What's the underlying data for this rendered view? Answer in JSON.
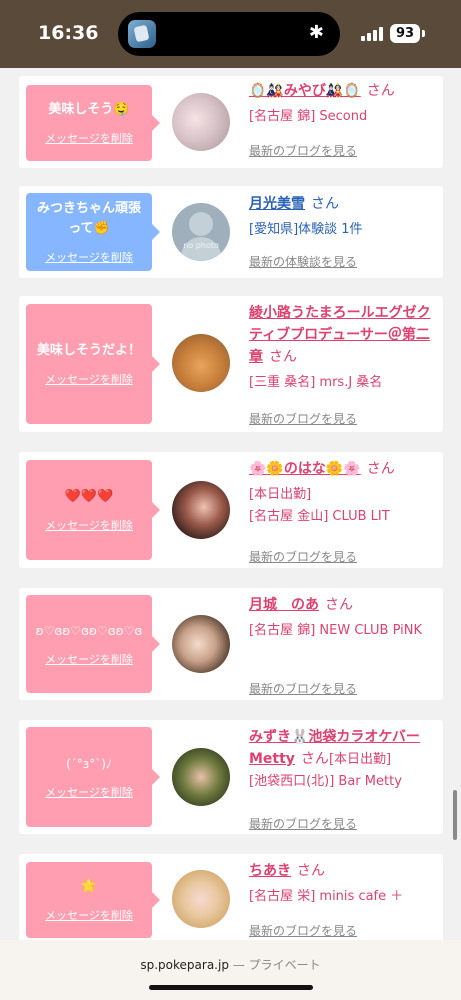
{
  "status": {
    "time": "16:36",
    "battery": "93"
  },
  "footer": {
    "domain": "sp.pokepara.jp",
    "mode": "— プライベート"
  },
  "cards": [
    {
      "message": "美味しそう🤤",
      "delete": "メッセージを削除",
      "name": "🪞🎎みやび🎎🪞",
      "san": "さん",
      "shop": "[名古屋 錦] Second",
      "blog": "最新のブログを見る"
    },
    {
      "message": "みつきちゃん頑張って✊",
      "delete": "メッセージを削除",
      "name": "月光美雪",
      "san": "さん",
      "shop": "[愛知県]体験談 1件",
      "blog": "最新の体験談を見る",
      "avatar_text": "no photo"
    },
    {
      "message": "美味しそうだよ！",
      "delete": "メッセージを削除",
      "name": "綾小路うたまろールエグゼクティブプロデューサー＠第二章",
      "san": "さん",
      "shop": "[三重 桑名] mrs.J 桑名",
      "blog": "最新のブログを見る"
    },
    {
      "message": "❤️❤️❤️",
      "delete": "メッセージを削除",
      "name": "🌸🌼のはな🌼🌸",
      "san": "さん",
      "shop": "[本日出勤]",
      "shop2": "[名古屋 金山] CLUB LIT",
      "blog": "最新のブログを見る"
    },
    {
      "message": "ʚ♡ɞʚ♡ɞʚ♡ɞʚ♡ɞ",
      "delete": "メッセージを削除",
      "name": "月城　のあ",
      "san": "さん",
      "shop": "[名古屋 錦] NEW CLUB PiNK",
      "blog": "最新のブログを見る"
    },
    {
      "message": "(´°з°`)ﾉ",
      "delete": "メッセージを削除",
      "name": "みずき🐰池袋カラオケバーMetty",
      "san": "さん",
      "shop": "[本日出勤]",
      "shop2": "[池袋西口(北)] Bar Metty",
      "blog": "最新のブログを見る"
    },
    {
      "message": "🌟",
      "delete": "メッセージを削除",
      "name": "ちあき",
      "san": "さん",
      "shop": "[名古屋 栄] minis cafe ＋",
      "blog": "最新のブログを見る"
    }
  ]
}
